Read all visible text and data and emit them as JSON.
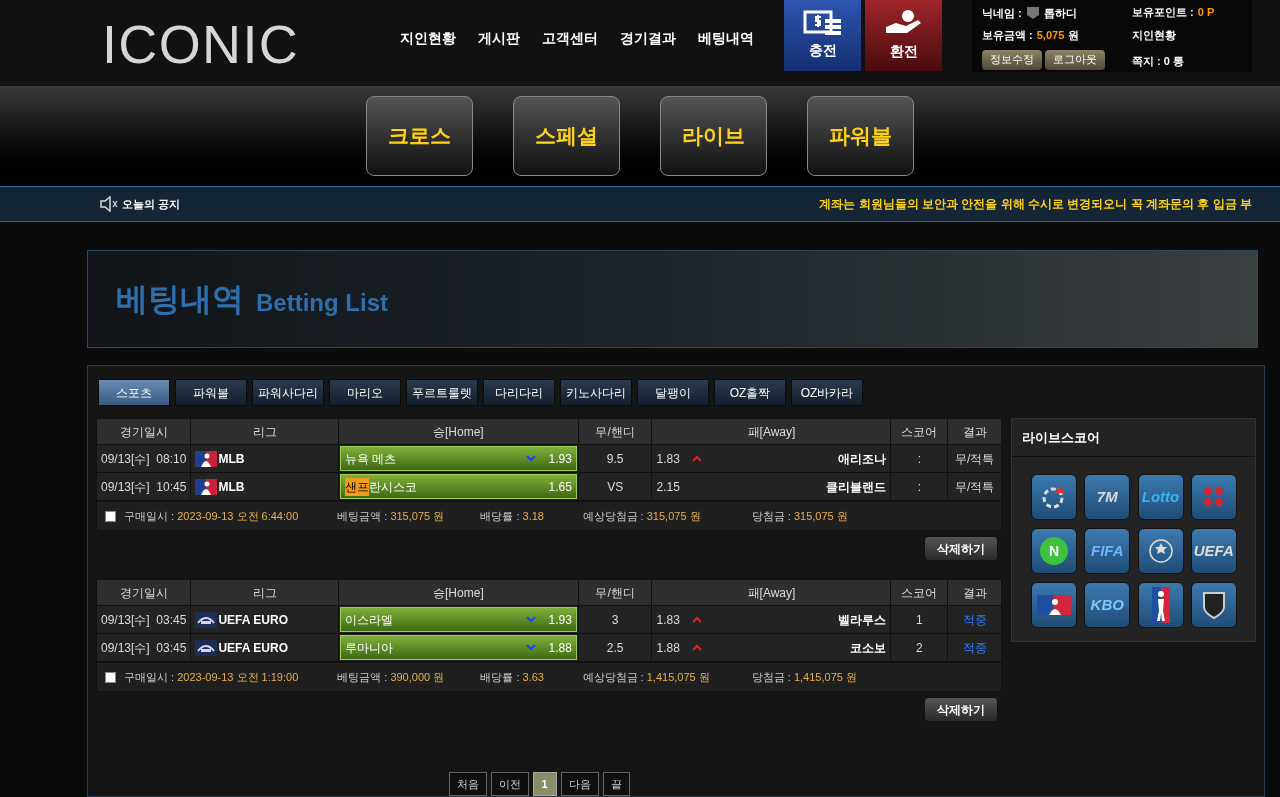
{
  "logo": "ICONIC",
  "nav": [
    "지인현황",
    "게시판",
    "고객센터",
    "경기결과",
    "베팅내역"
  ],
  "cash_buttons": [
    {
      "kind": "deposit",
      "label": "충전"
    },
    {
      "kind": "withdraw",
      "label": "환전"
    }
  ],
  "user": {
    "nickname_label": "닉네임 :",
    "nickname": "톱하디",
    "balance_label": "보유금액 :",
    "balance": "5,075",
    "balance_unit": "원",
    "points_label": "보유포인트 :",
    "points": "0 P",
    "referral": "지인현황",
    "messages": "쪽지 : 0 통",
    "buttons": [
      "정보수정",
      "로그아웃"
    ]
  },
  "games": [
    "크로스",
    "스페셜",
    "라이브",
    "파워볼"
  ],
  "notice": {
    "label": "오늘의 공지",
    "text": "계좌는 회원님들의 보안과 안전을 위해 수시로 변경되오니 꼭 계좌문의 후 입금 부"
  },
  "banner": {
    "title": "베팅내역",
    "subtitle": "Betting List"
  },
  "tabs": [
    {
      "label": "스포츠",
      "selected": true
    },
    {
      "label": "파워볼",
      "selected": false
    },
    {
      "label": "파워사다리",
      "selected": false
    },
    {
      "label": "마리오",
      "selected": false
    },
    {
      "label": "푸르트룰렛",
      "selected": false
    },
    {
      "label": "다리다리",
      "selected": false
    },
    {
      "label": "키노사다리",
      "selected": false
    },
    {
      "label": "달팽이",
      "selected": false
    },
    {
      "label": "OZ홀짝",
      "selected": false
    },
    {
      "label": "OZ바카라",
      "selected": false
    }
  ],
  "bets": [
    {
      "columns": [
        "경기일시",
        "리그",
        "승[Home]",
        "무/핸디",
        "패[Away]",
        "스코어",
        "결과"
      ],
      "rows": [
        {
          "date": "09/13[수]  08:10",
          "league": {
            "kind": "mlb",
            "name": "MLB"
          },
          "home_mark": null,
          "home": "뉴욕 메츠",
          "home_down": true,
          "home_odds": "1.93",
          "handi": "9.5",
          "away_odds": "1.83",
          "away_up": true,
          "away": "애리조나",
          "score": ":",
          "result": "무/적특",
          "hit": false
        },
        {
          "date": "09/13[수]  10:45",
          "league": {
            "kind": "mlb",
            "name": "MLB"
          },
          "home_mark": "샌프",
          "home": "란시스코",
          "home_down": false,
          "home_odds": "1.65",
          "handi": "VS",
          "away_odds": "2.15",
          "away_up": false,
          "away": "클리블랜드",
          "score": ":",
          "result": "무/적특",
          "hit": false
        }
      ],
      "checked": false,
      "buy_label": "구매일시 :",
      "buy": "2023-09-13 오전 6:44:00",
      "amount_label": "베팅금액 :",
      "amount": "315,075 원",
      "rate_label": "배당률 :",
      "rate": "3.18",
      "expected_label": "예상당첨금 :",
      "expected": "315,075 원",
      "win_label": "당첨금 :",
      "win": "315,075 원",
      "delete": "삭제하기"
    },
    {
      "columns": [
        "경기일시",
        "리그",
        "승[Home]",
        "무/핸디",
        "패[Away]",
        "스코어",
        "결과"
      ],
      "rows": [
        {
          "date": "09/13[수]  03:45",
          "league": {
            "kind": "uefa",
            "name": "UEFA EURO"
          },
          "home_mark": null,
          "home": "이스라엘",
          "home_down": true,
          "home_odds": "1.93",
          "handi": "3",
          "away_odds": "1.83",
          "away_up": true,
          "away": "벨라루스",
          "score": "1",
          "result": "적중",
          "hit": true
        },
        {
          "date": "09/13[수]  03:45",
          "league": {
            "kind": "uefa",
            "name": "UEFA EURO"
          },
          "home_mark": null,
          "home": "루마니아",
          "home_down": true,
          "home_odds": "1.88",
          "handi": "2.5",
          "away_odds": "1.88",
          "away_up": true,
          "away": "코소보",
          "score": "2",
          "result": "적중",
          "hit": true
        }
      ],
      "checked": false,
      "buy_label": "구매일시 :",
      "buy": "2023-09-13 오전 1:19:00",
      "amount_label": "베팅금액 :",
      "amount": "390,000 원",
      "rate_label": "배당률 :",
      "rate": "3.63",
      "expected_label": "예상당첨금 :",
      "expected": "1,415,075 원",
      "win_label": "당첨금 :",
      "win": "1,415,075 원",
      "delete": "삭제하기"
    }
  ],
  "pagination": [
    {
      "label": "처음",
      "selected": false
    },
    {
      "label": "이전",
      "selected": false
    },
    {
      "label": "1",
      "selected": true
    },
    {
      "label": "다음",
      "selected": false
    },
    {
      "label": "끝",
      "selected": false
    }
  ],
  "livescore": {
    "title": "라이브스코어",
    "logos": [
      {
        "kind": "ring"
      },
      {
        "kind": "text",
        "text": "7M",
        "color": "#d9d9d9"
      },
      {
        "kind": "text",
        "text": "Lotto",
        "color": "#3ab4f2"
      },
      {
        "kind": "diamonds"
      },
      {
        "kind": "circle",
        "text": "N",
        "color": "#3cc23c"
      },
      {
        "kind": "text",
        "text": "FIFA",
        "color": "#6fb4ff"
      },
      {
        "kind": "ball"
      },
      {
        "kind": "text",
        "text": "UEFA",
        "color": "#dddddd"
      },
      {
        "kind": "batter"
      },
      {
        "kind": "text",
        "text": "KBO",
        "color": "#7cc8ff"
      },
      {
        "kind": "player"
      },
      {
        "kind": "shield"
      }
    ]
  }
}
